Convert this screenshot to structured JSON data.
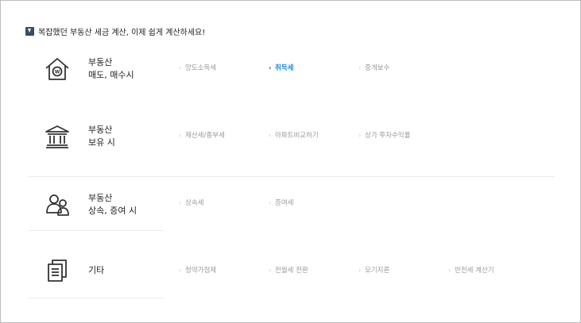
{
  "header": {
    "text": "복잡했던 부동산 세금 계산, 이제 쉽게 계산하세요!"
  },
  "sections": [
    {
      "icon": "house-won-icon",
      "label_line1": "부동산",
      "label_line2": "매도, 매수시",
      "links": [
        "양도소득세",
        "취득세",
        "중개보수"
      ],
      "active_index": 1
    },
    {
      "icon": "bank-building-icon",
      "label_line1": "부동산",
      "label_line2": "보유 시",
      "links": [
        "재산세/종부세",
        "아파트비교하기",
        "상가 투자수익률"
      ]
    },
    {
      "icon": "family-people-icon",
      "label_line1": "부동산",
      "label_line2": "상속, 증여 시",
      "links": [
        "상속세",
        "증여세"
      ]
    },
    {
      "icon": "copy-document-icon",
      "label_line1": "기타",
      "links": [
        "청약가점제",
        "전월세 전환",
        "모기지론",
        "반전세 계산기"
      ]
    }
  ],
  "colors": {
    "active_link": "#1b8bd6",
    "inactive_link": "#9a9a9a",
    "divider": "#ececec",
    "border": "#bdbdbd"
  }
}
